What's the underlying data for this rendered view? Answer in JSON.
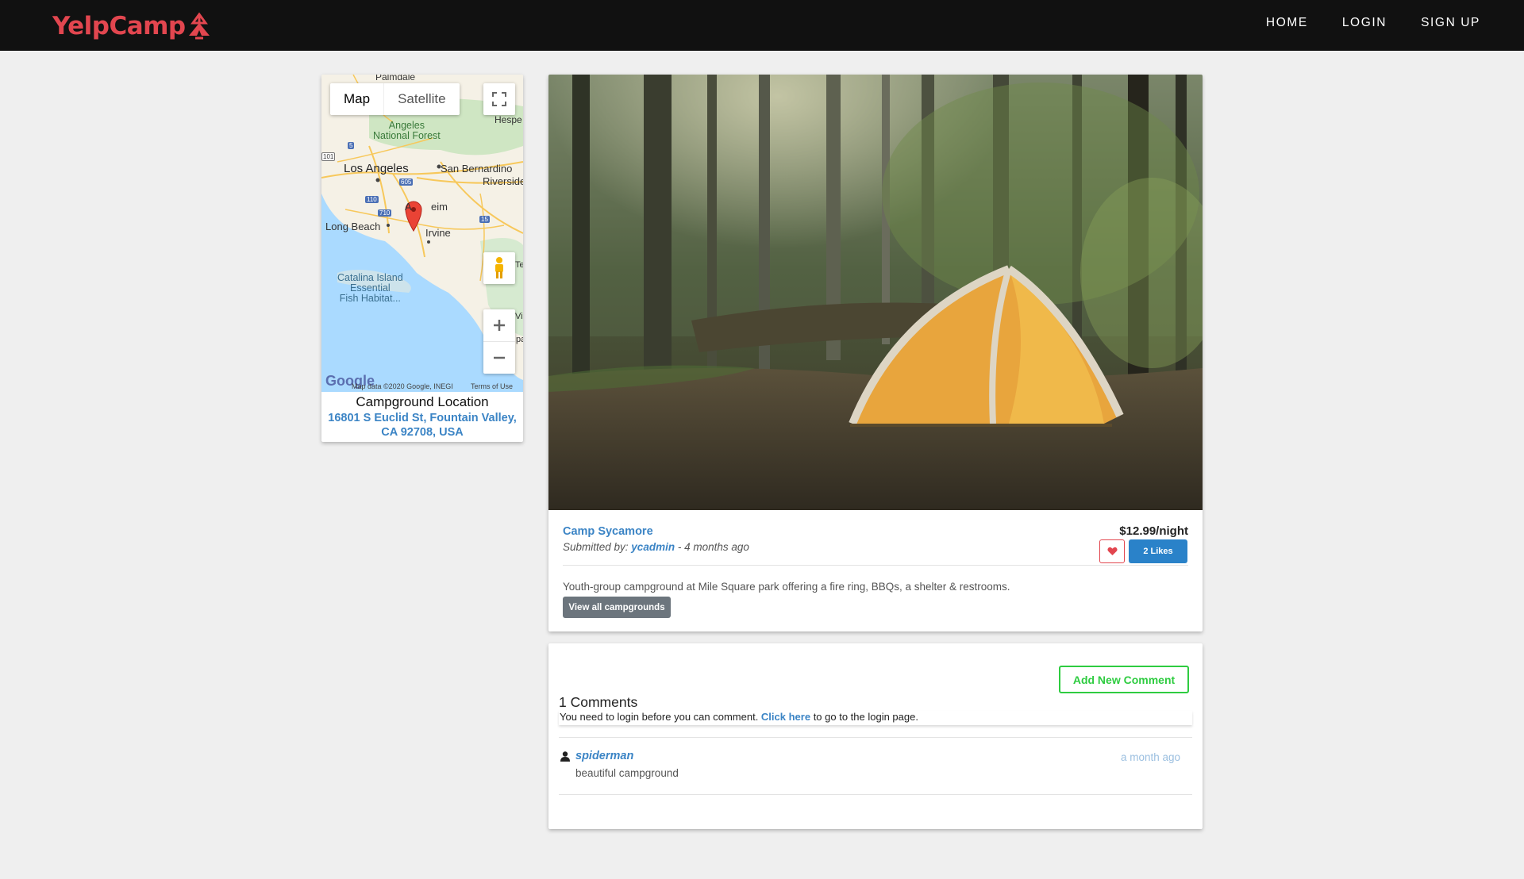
{
  "nav": {
    "brand": "YelpCamp",
    "links": [
      "HOME",
      "LOGIN",
      "SIGN UP"
    ]
  },
  "map": {
    "toggle": [
      "Map",
      "Satellite"
    ],
    "labels": {
      "palmdale": "Palmdale",
      "hesperia": "Hespe",
      "angeles_forest": "Angeles\nNational Forest",
      "los_angeles": "Los Angeles",
      "san_bernardino": "San Bernardino",
      "riverside": "Riverside",
      "anaheim": "eim",
      "anaheim_prefix": "A",
      "irvine": "Irvine",
      "long_beach": "Long Beach",
      "catalina": "Catalina Island\nEssential\nFish Habitat...",
      "te": "Te",
      "vis": "Vis",
      "pa": "pa",
      "shield_5": "5",
      "shield_605": "605",
      "shield_110": "110",
      "shield_710": "710",
      "shield_15": "15",
      "shield_101": "101"
    },
    "google": "Google",
    "footer": "Map data ©2020 Google, INEGI",
    "terms": "Terms of Use",
    "caption_title": "Campground Location",
    "caption_address": "16801 S Euclid St, Fountain Valley, CA 92708, USA"
  },
  "campground": {
    "name": "Camp Sycamore",
    "submitted_prefix": "Submitted by: ",
    "author": "ycadmin",
    "time": " - 4 months ago",
    "price": "$12.99/night",
    "likes": "2 Likes",
    "description": "Youth-group campground at Mile Square park offering a fire ring, BBQs, a shelter & restrooms.",
    "view_all": "View all campgrounds"
  },
  "comments": {
    "add_button": "Add New Comment",
    "count_label": "1 Comments",
    "notice_before": "You need to login before you can comment. ",
    "notice_link": "Click here",
    "notice_after": " to go to the login page.",
    "items": [
      {
        "author": "spiderman",
        "time": "a month ago",
        "text": "beautiful campground"
      }
    ]
  },
  "colors": {
    "brand": "#e2464f",
    "link": "#3b84c5",
    "success": "#2ecc40",
    "primary": "#2a82c9"
  }
}
